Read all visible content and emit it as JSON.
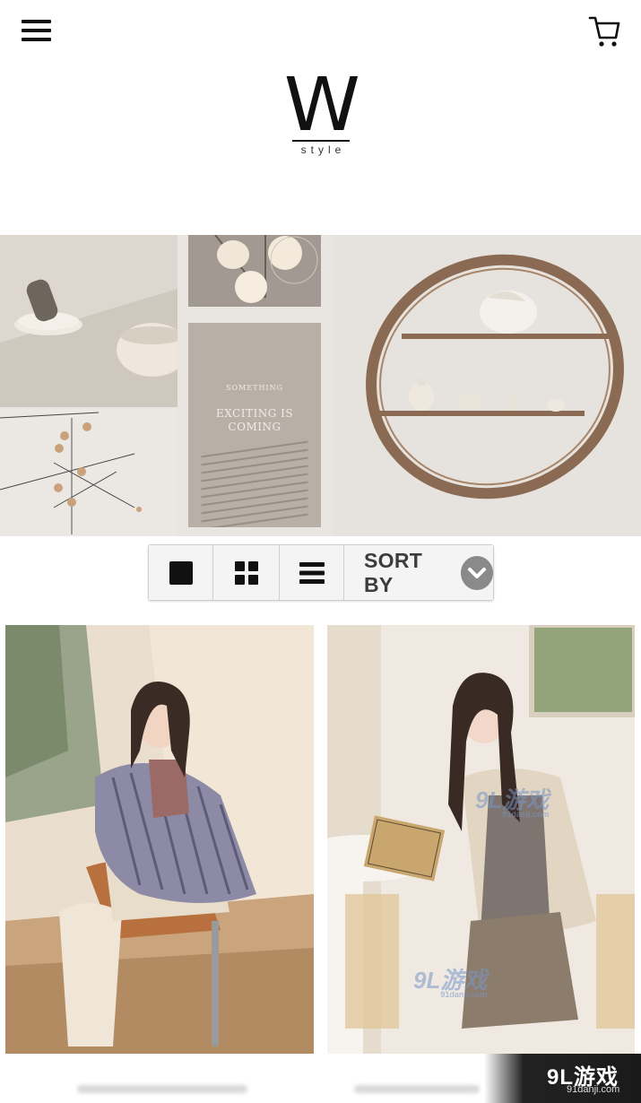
{
  "header": {
    "logo_mark": "W",
    "logo_sub": "style",
    "menu_icon": "hamburger-menu-icon",
    "cart_icon": "shopping-cart-icon"
  },
  "hero": {
    "card_small": "SOMETHING",
    "card_large": "EXCITING IS COMING"
  },
  "toolbar": {
    "views": [
      {
        "icon": "single-view-icon",
        "label": ""
      },
      {
        "icon": "grid-view-icon",
        "label": ""
      },
      {
        "icon": "list-view-icon",
        "label": ""
      }
    ],
    "sort_label": "SORT BY",
    "sort_icon": "chevron-down-icon"
  },
  "watermark": {
    "brand": "9L游戏",
    "domain": "91danji.com"
  },
  "colors": {
    "icon_dark": "#111111",
    "toolbar_bg": "#f4f4f4",
    "sort_chevron_bg": "#8a8a8a"
  }
}
